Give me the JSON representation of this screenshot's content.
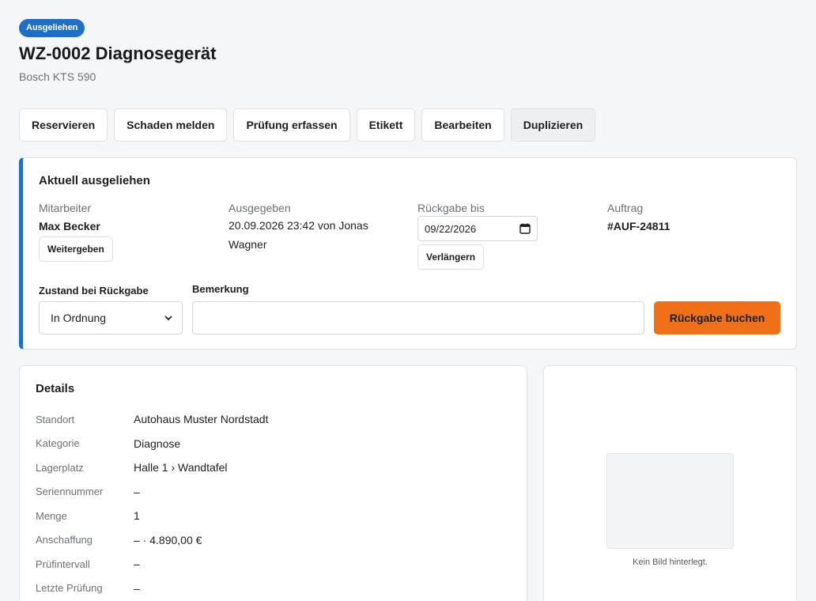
{
  "status_badge": "Ausgeliehen",
  "title": "WZ-0002 Diagnosegerät",
  "subtitle": "Bosch KTS 590",
  "actions": [
    {
      "label": "Reservieren"
    },
    {
      "label": "Schaden melden"
    },
    {
      "label": "Prüfung erfassen"
    },
    {
      "label": "Etikett"
    },
    {
      "label": "Bearbeiten"
    },
    {
      "label": "Duplizieren"
    }
  ],
  "loan": {
    "heading": "Aktuell ausgeliehen",
    "employee_label": "Mitarbeiter",
    "employee": "Max Becker",
    "forward_button": "Weitergeben",
    "issued_label": "Ausgegeben",
    "issued_value": "20.09.2026 23:42 von Jonas Wagner",
    "return_label": "Rückgabe bis",
    "return_date": "09/22/2026",
    "extend_button": "Verlängern",
    "order_label": "Auftrag",
    "order_value": "#AUF-24811",
    "condition_label": "Zustand bei Rückgabe",
    "condition_value": "In Ordnung",
    "remark_label": "Bemerkung",
    "remark_value": "",
    "submit_button": "Rückgabe buchen"
  },
  "details": {
    "heading": "Details",
    "rows": [
      {
        "key": "Standort",
        "value": "Autohaus Muster Nordstadt"
      },
      {
        "key": "Kategorie",
        "value": "Diagnose"
      },
      {
        "key": "Lagerplatz",
        "value": "Halle 1 › Wandtafel"
      },
      {
        "key": "Seriennummer",
        "value": "–"
      },
      {
        "key": "Menge",
        "value": "1"
      },
      {
        "key": "Anschaffung",
        "value": "– · 4.890,00 €"
      },
      {
        "key": "Prüfintervall",
        "value": "–"
      },
      {
        "key": "Letzte Prüfung",
        "value": "–"
      }
    ]
  },
  "image": {
    "caption": "Kein Bild hinterlegt."
  },
  "colors": {
    "accent": "#1f6fc4",
    "primary_action": "#f07019"
  }
}
